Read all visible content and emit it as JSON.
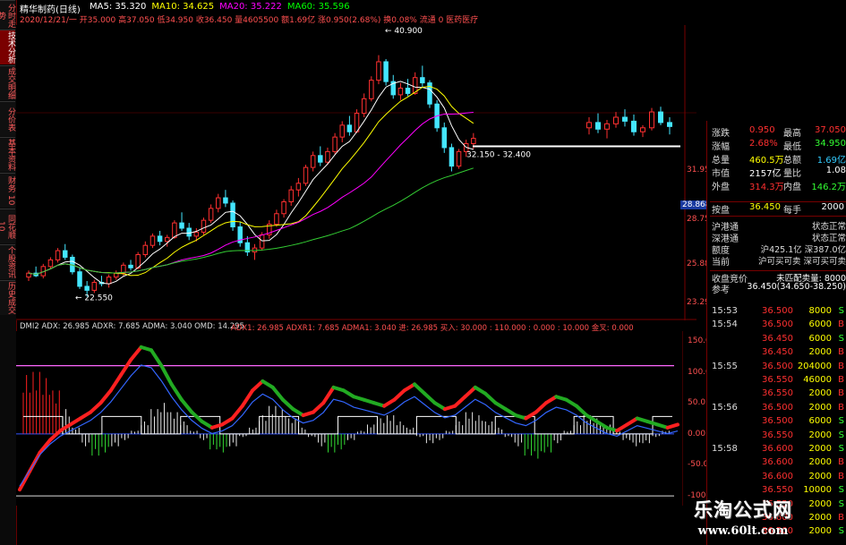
{
  "header": {
    "title": "精华制药(日线)",
    "ma": [
      {
        "label": "MA5: 35.320",
        "color": "#ffffff"
      },
      {
        "label": "MA10: 34.625",
        "color": "#ffff00"
      },
      {
        "label": "MA20: 35.222",
        "color": "#ff00ff"
      },
      {
        "label": "MA60: 35.596",
        "color": "#00ff00"
      }
    ],
    "info_line": "2020/12/21/一 开35.000 高37.050 低34.950 收36.450 量4605500 额1.69亿 涨0.950(2.68%) 换0.08% 流通 0 医药医疗"
  },
  "sidebar": {
    "top_label": "分时走势",
    "items": [
      {
        "label": "技术分析",
        "active": true
      },
      {
        "label": "成交明细",
        "active": false
      },
      {
        "label": "分价表",
        "active": false
      },
      {
        "label": "基本资料",
        "active": false
      },
      {
        "label": "财务 10",
        "active": false
      },
      {
        "label": "同花顺 10",
        "active": false
      },
      {
        "label": "个股资讯",
        "active": false
      },
      {
        "label": "历史成交",
        "active": false
      }
    ]
  },
  "price_chart": {
    "annotations": {
      "high": "40.900",
      "low": "22.550",
      "gap": "32.150 - 32.400"
    },
    "axis_labels": [
      "31.95",
      "28.75",
      "25.88",
      "23.29"
    ],
    "current_price_tag": "28.868",
    "candles": [
      [
        24.1,
        24.6,
        23.8,
        24.4
      ],
      [
        24.4,
        24.9,
        24.1,
        24.2
      ],
      [
        24.2,
        25.1,
        24.0,
        24.9
      ],
      [
        24.9,
        25.6,
        24.7,
        25.4
      ],
      [
        25.4,
        26.3,
        25.2,
        26.1
      ],
      [
        26.1,
        26.6,
        25.4,
        25.6
      ],
      [
        25.6,
        25.8,
        24.3,
        24.5
      ],
      [
        24.5,
        24.8,
        23.2,
        23.4
      ],
      [
        23.4,
        23.8,
        22.6,
        23.1
      ],
      [
        23.1,
        23.9,
        22.9,
        23.7
      ],
      [
        23.7,
        24.2,
        23.4,
        23.6
      ],
      [
        23.6,
        24.3,
        23.3,
        24.1
      ],
      [
        24.1,
        24.6,
        23.9,
        24.4
      ],
      [
        24.4,
        25.2,
        24.2,
        25.0
      ],
      [
        25.0,
        25.4,
        24.6,
        24.8
      ],
      [
        24.8,
        26.0,
        24.7,
        25.8
      ],
      [
        25.8,
        26.8,
        25.6,
        26.5
      ],
      [
        26.5,
        27.4,
        26.3,
        27.2
      ],
      [
        27.2,
        27.6,
        26.5,
        26.8
      ],
      [
        26.8,
        27.3,
        26.4,
        27.1
      ],
      [
        27.1,
        28.4,
        27.0,
        28.2
      ],
      [
        28.2,
        29.0,
        27.6,
        27.8
      ],
      [
        27.8,
        28.2,
        26.9,
        27.2
      ],
      [
        27.2,
        27.8,
        26.8,
        27.5
      ],
      [
        27.5,
        28.6,
        27.3,
        28.4
      ],
      [
        28.4,
        29.6,
        28.2,
        29.3
      ],
      [
        29.3,
        30.4,
        29.0,
        30.1
      ],
      [
        30.1,
        30.7,
        29.4,
        29.7
      ],
      [
        29.7,
        29.9,
        27.6,
        27.9
      ],
      [
        27.9,
        28.3,
        26.4,
        26.7
      ],
      [
        26.7,
        27.2,
        25.7,
        26.0
      ],
      [
        26.0,
        26.6,
        25.4,
        26.3
      ],
      [
        26.3,
        27.5,
        26.1,
        27.3
      ],
      [
        27.3,
        28.4,
        27.0,
        28.1
      ],
      [
        28.1,
        29.2,
        27.9,
        28.9
      ],
      [
        28.9,
        30.0,
        28.6,
        29.8
      ],
      [
        29.8,
        31.0,
        29.5,
        30.7
      ],
      [
        30.7,
        31.6,
        30.2,
        31.2
      ],
      [
        31.2,
        32.6,
        31.0,
        32.4
      ],
      [
        32.4,
        33.6,
        32.1,
        33.3
      ],
      [
        33.3,
        34.0,
        32.5,
        32.8
      ],
      [
        32.8,
        33.9,
        32.6,
        33.6
      ],
      [
        33.6,
        35.0,
        33.4,
        34.7
      ],
      [
        34.7,
        35.9,
        34.3,
        35.6
      ],
      [
        35.6,
        36.3,
        34.8,
        35.1
      ],
      [
        35.1,
        36.8,
        35.0,
        36.5
      ],
      [
        36.5,
        38.0,
        36.2,
        37.6
      ],
      [
        37.6,
        39.3,
        37.4,
        39.0
      ],
      [
        39.0,
        40.9,
        38.7,
        40.4
      ],
      [
        40.4,
        40.6,
        38.6,
        38.9
      ],
      [
        38.9,
        39.4,
        37.6,
        37.9
      ],
      [
        37.9,
        38.8,
        37.5,
        38.4
      ],
      [
        38.4,
        39.1,
        37.8,
        38.0
      ],
      [
        38.0,
        39.6,
        37.9,
        39.2
      ],
      [
        39.2,
        40.1,
        38.5,
        38.8
      ],
      [
        38.8,
        39.0,
        36.9,
        37.2
      ],
      [
        37.2,
        37.5,
        35.1,
        35.4
      ],
      [
        35.4,
        35.8,
        33.5,
        33.9
      ],
      [
        33.9,
        34.2,
        32.1,
        32.5
      ],
      [
        32.5,
        33.8,
        32.3,
        33.6
      ],
      [
        33.6,
        34.5,
        33.2,
        34.2
      ],
      [
        34.2,
        35.0,
        33.8,
        34.6
      ]
    ],
    "right_candles": [
      [
        35.4,
        36.2,
        34.9,
        35.8
      ],
      [
        35.8,
        36.5,
        35.0,
        35.3
      ],
      [
        35.3,
        36.0,
        34.6,
        35.7
      ],
      [
        35.7,
        36.6,
        35.4,
        36.2
      ],
      [
        36.2,
        36.8,
        35.5,
        35.9
      ],
      [
        35.9,
        36.4,
        34.8,
        35.1
      ],
      [
        35.1,
        35.6,
        34.7,
        35.4
      ],
      [
        35.4,
        36.9,
        35.2,
        36.6
      ],
      [
        36.6,
        37.0,
        35.6,
        35.8
      ],
      [
        35.8,
        36.2,
        34.9,
        35.5
      ]
    ],
    "price_range": [
      21.5,
      42.5
    ],
    "ma_colors": {
      "ma5": "#ffffff",
      "ma10": "#ffff00",
      "ma20": "#ff00ff",
      "ma60": "#33cc33"
    }
  },
  "indicator": {
    "header": "DMI2 ADX: 26.985 ADXR: 7.685 ADMA: 3.040 OMD: 14.295",
    "header2": "ADX1: 26.985 ADXR1: 7.685 ADMA1: 3.040 进: 26.985 买入: 30.000 : 110.000 : 0.000 : 10.000 金叉: 0.000",
    "axis_labels": [
      "150.0",
      "100.0",
      "50.0",
      "0.00",
      "-50.0",
      "-100.0"
    ],
    "range": [
      -110,
      160
    ],
    "levels": {
      "upper": 110,
      "lower": -100
    },
    "histogram": [
      95,
      100,
      90,
      70,
      40,
      10,
      -20,
      -35,
      -30,
      -20,
      -10,
      5,
      20,
      40,
      50,
      35,
      20,
      5,
      -10,
      -25,
      -30,
      -20,
      -5,
      10,
      30,
      45,
      40,
      25,
      10,
      -5,
      -20,
      -30,
      -25,
      -10,
      5,
      15,
      25,
      30,
      20,
      10,
      -5,
      -15,
      -10,
      5,
      20,
      35,
      30,
      20,
      10,
      -5,
      -20,
      -35,
      -40,
      -30,
      -15,
      5,
      20,
      30,
      25,
      15,
      5,
      -10,
      -20,
      -15,
      -5,
      5
    ],
    "adx_line": [
      -90,
      -60,
      -30,
      -10,
      5,
      15,
      25,
      35,
      50,
      70,
      95,
      120,
      140,
      135,
      110,
      80,
      55,
      35,
      20,
      10,
      15,
      25,
      45,
      70,
      85,
      75,
      55,
      40,
      30,
      35,
      50,
      75,
      70,
      60,
      55,
      50,
      45,
      55,
      70,
      80,
      65,
      50,
      40,
      45,
      60,
      75,
      65,
      50,
      40,
      30,
      25,
      35,
      50,
      60,
      55,
      45,
      30,
      20,
      10,
      5,
      15,
      25,
      20,
      15,
      10,
      15
    ]
  },
  "quote_panel": {
    "rows": [
      {
        "k1": "涨跌",
        "v1": "0.950",
        "v1c": "#ff3030",
        "k2": "最高",
        "v2": "37.050",
        "v2c": "#ff3030"
      },
      {
        "k1": "涨幅",
        "v1": "2.68%",
        "v1c": "#ff3030",
        "k2": "最低",
        "v2": "34.950",
        "v2c": "#33ff33"
      },
      {
        "k1": "总量",
        "v1": "460.5万",
        "v1c": "#ffff00",
        "k2": "总额",
        "v2": "1.69亿",
        "v2c": "#33ccff"
      },
      {
        "k1": "市值",
        "v1": "2157亿",
        "v1c": "#ffffff",
        "k2": "量比",
        "v2": "1.08",
        "v2c": "#ffffff"
      },
      {
        "k1": "外盘",
        "v1": "314.3万",
        "v1c": "#ff3030",
        "k2": "内盘",
        "v2": "146.2万",
        "v2c": "#33ff33"
      }
    ],
    "bid_row": {
      "label": "按盘",
      "value": "36.450",
      "label2": "每手",
      "value2": "2000"
    },
    "status_rows": [
      {
        "k": "沪港通",
        "v": "状态正常"
      },
      {
        "k": "深港通",
        "v": "状态正常"
      },
      {
        "k": "额度",
        "v": "沪425.1亿 深387.0亿"
      },
      {
        "k": "当前",
        "v": "沪可买可卖 深可买可卖"
      }
    ],
    "auction": {
      "k": "收盘竞价",
      "v": "未匹配卖量: 8000"
    },
    "ref": {
      "k": "参考",
      "v": "36.450(34.650-38.250)"
    },
    "ticks": [
      {
        "time": "15:53",
        "price": "36.500",
        "vol": "8000",
        "flag": "S"
      },
      {
        "time": "15:54",
        "price": "36.500",
        "vol": "6000",
        "flag": "B"
      },
      {
        "time": "",
        "price": "36.450",
        "vol": "6000",
        "flag": "S"
      },
      {
        "time": "",
        "price": "36.450",
        "vol": "2000",
        "flag": "B"
      },
      {
        "time": "15:55",
        "price": "36.500",
        "vol": "204000",
        "flag": "B"
      },
      {
        "time": "",
        "price": "36.550",
        "vol": "46000",
        "flag": "B"
      },
      {
        "time": "",
        "price": "36.550",
        "vol": "2000",
        "flag": "B"
      },
      {
        "time": "15:56",
        "price": "36.500",
        "vol": "2000",
        "flag": "B"
      },
      {
        "time": "",
        "price": "36.500",
        "vol": "6000",
        "flag": "S"
      },
      {
        "time": "",
        "price": "36.550",
        "vol": "2000",
        "flag": "S"
      },
      {
        "time": "15:58",
        "price": "36.600",
        "vol": "2000",
        "flag": "S"
      },
      {
        "time": "",
        "price": "36.600",
        "vol": "2000",
        "flag": "B"
      },
      {
        "time": "",
        "price": "36.600",
        "vol": "2000",
        "flag": "B"
      },
      {
        "time": "",
        "price": "36.550",
        "vol": "10000",
        "flag": "S"
      },
      {
        "time": "",
        "price": "36.550",
        "vol": "2000",
        "flag": "S"
      },
      {
        "time": "",
        "price": "36.600",
        "vol": "2000",
        "flag": "B"
      },
      {
        "time": "",
        "price": "36.500",
        "vol": "2000",
        "flag": "S"
      }
    ]
  },
  "watermark": {
    "line1": "乐淘公式网",
    "line2": "www.60lt.com"
  }
}
